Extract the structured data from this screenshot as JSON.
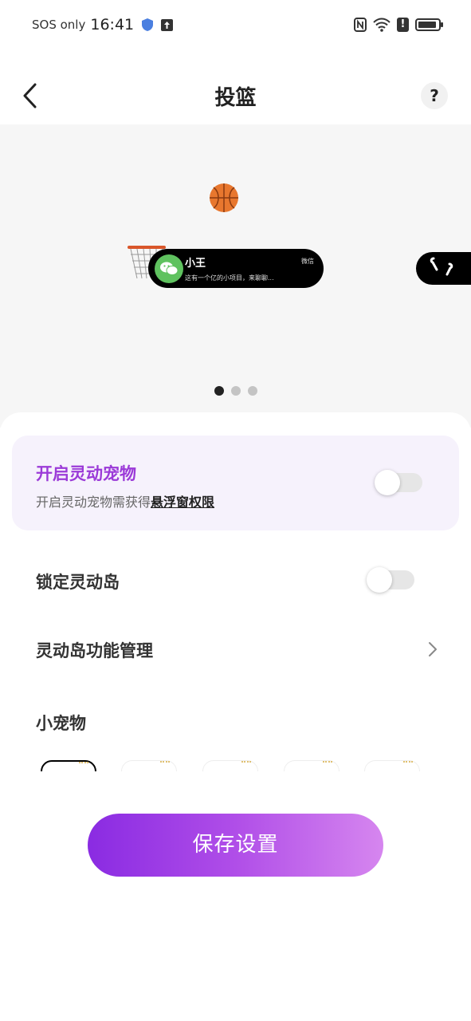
{
  "statusbar": {
    "carrier": "SOS only",
    "time": "16:41",
    "alert": "!"
  },
  "header": {
    "title": "投篮",
    "help": "?"
  },
  "preview": {
    "notification": {
      "name": "小王",
      "app": "微信",
      "message": "这有一个亿的小项目，来聊聊..."
    },
    "dots_active_index": 0,
    "dots_count": 3
  },
  "pet_card": {
    "title": "开启灵动宠物",
    "subtitle_prefix": "开启灵动宠物需获得",
    "subtitle_link": "悬浮窗权限",
    "toggle_on": false
  },
  "settings": {
    "lock_label": "锁定灵动岛",
    "lock_on": false,
    "manage_label": "灵动岛功能管理",
    "pets_label": "小宠物"
  },
  "save_label": "保存设置",
  "colors": {
    "accent": "#9b3ad8",
    "card_bg": "#f6f2fc",
    "gradient_start": "#8a2be2",
    "gradient_end": "#d686ef"
  }
}
